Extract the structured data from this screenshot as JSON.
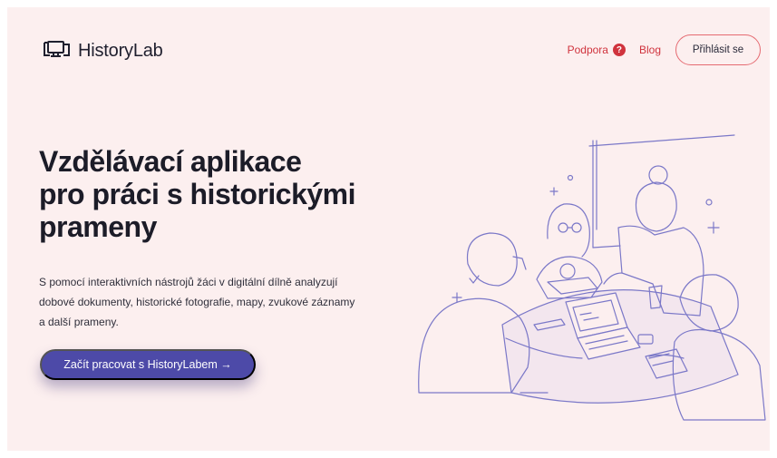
{
  "header": {
    "logo_text": "HistoryLab",
    "nav": {
      "support_label": "Podpora",
      "support_icon": "?",
      "blog_label": "Blog",
      "login_label": "Přihlásit se"
    }
  },
  "hero": {
    "title_line1": "Vzdělávací aplikace",
    "title_line2": "pro práci s historickými",
    "title_line3": "prameny",
    "description_line1": "S pomocí interaktivních nástrojů žáci v digitální dílně analyzují",
    "description_line2": "dobové dokumenty, historické fotografie, mapy, zvukové záznamy",
    "description_line3": "a další prameny.",
    "cta_label": "Začít pracovat s HistoryLabem →"
  },
  "colors": {
    "background": "#fcefef",
    "accent_red": "#d0333d",
    "cta_purple": "#4d4aa8",
    "illustration_stroke": "#7b78c8"
  }
}
